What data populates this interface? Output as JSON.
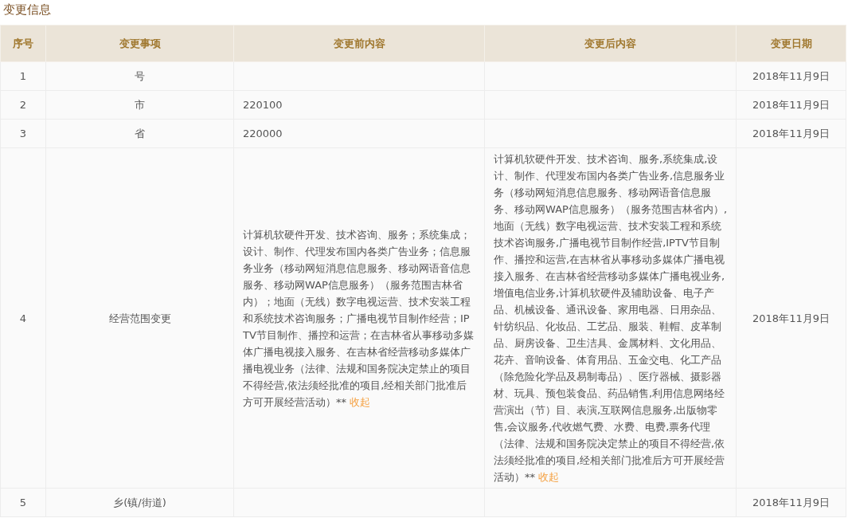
{
  "title": "变更信息",
  "table": {
    "columns": [
      "序号",
      "变更事项",
      "变更前内容",
      "变更后内容",
      "变更日期"
    ],
    "rows": [
      {
        "index": "1",
        "item": "号",
        "date": "2018年11月9日"
      },
      {
        "index": "2",
        "item": "市",
        "before": {
          "text": "220100"
        },
        "date": "2018年11月9日"
      },
      {
        "index": "3",
        "item": "省",
        "before": {
          "text": "220000"
        },
        "date": "2018年11月9日"
      },
      {
        "index": "4",
        "item": "经营范围变更",
        "before": {
          "text": "计算机软硬件开发、技术咨询、服务；系统集成；设计、制作、代理发布国内各类广告业务；信息服务业务（移动网短消息信息服务、移动网语音信息服务、移动网WAP信息服务）（服务范围吉林省内）；地面（无线）数字电视运营、技术安装工程和系统技术咨询服务；广播电视节目制作经营；IPTV节目制作、播控和运营；在吉林省从事移动多媒体广播电视接入服务、在吉林省经营移动多媒体广播电视业务（法律、法规和国务院决定禁止的项目不得经营,依法须经批准的项目,经相关部门批准后方可开展经营活动）**",
          "toggle": "收起"
        },
        "after": {
          "text": "计算机软硬件开发、技术咨询、服务,系统集成,设计、制作、代理发布国内各类广告业务,信息服务业务（移动网短消息信息服务、移动网语音信息服务、移动网WAP信息服务）（服务范围吉林省内）,地面（无线）数字电视运营、技术安装工程和系统技术咨询服务,广播电视节目制作经营,IPTV节目制作、播控和运营,在吉林省从事移动多媒体广播电视接入服务、在吉林省经营移动多媒体广播电视业务,增值电信业务,计算机软硬件及辅助设备、电子产品、机械设备、通讯设备、家用电器、日用杂品、针纺织品、化妆品、工艺品、服装、鞋帽、皮革制品、厨房设备、卫生洁具、金属材料、文化用品、花卉、音响设备、体育用品、五金交电、化工产品（除危险化学品及易制毒品）、医疗器械、摄影器材、玩具、预包装食品、药品销售,利用信息网络经营演出（节）目、表演,互联网信息服务,出版物零售,会议服务,代收燃气费、水费、电费,票务代理（法律、法规和国务院决定禁止的项目不得经营,依法须经批准的项目,经相关部门批准后方可开展经营活动）**",
          "toggle": "收起"
        },
        "date": "2018年11月9日"
      },
      {
        "index": "5",
        "item": "乡(镇/街道)",
        "date": "2018年11月9日"
      }
    ]
  }
}
